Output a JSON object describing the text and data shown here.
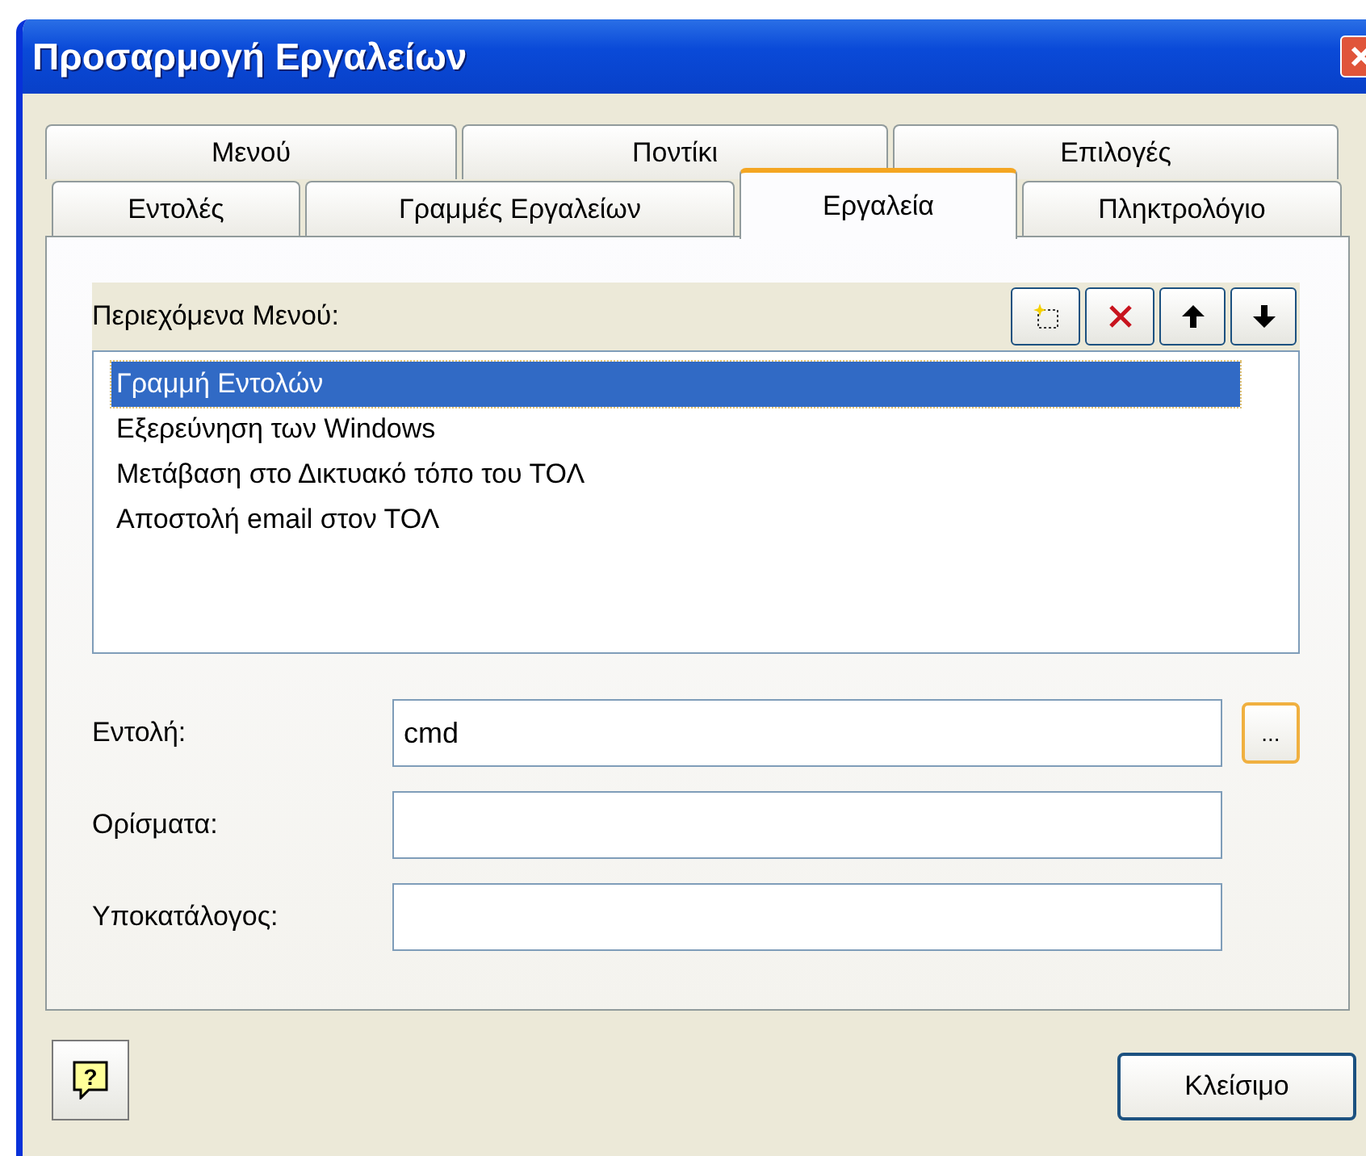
{
  "window": {
    "title": "Προσαρμογή Εργαλείων"
  },
  "tab_rows": [
    [
      {
        "label": "Μενού",
        "selected": false
      },
      {
        "label": "Ποντίκι",
        "selected": false
      },
      {
        "label": "Επιλογές",
        "selected": false
      }
    ],
    [
      {
        "label": "Εντολές",
        "selected": false
      },
      {
        "label": "Γραμμές Εργαλείων",
        "selected": false
      },
      {
        "label": "Εργαλεία",
        "selected": true
      },
      {
        "label": "Πληκτρολόγιο",
        "selected": false
      }
    ]
  ],
  "menu_contents": {
    "label": "Περιεχόμενα Μενού:",
    "items": [
      {
        "label": "Γραμμή Εντολών",
        "selected": true
      },
      {
        "label": "Εξερεύνηση των Windows",
        "selected": false
      },
      {
        "label": "Μετάβαση στο Δικτυακό τόπο του ΤΟΛ",
        "selected": false
      },
      {
        "label": "Αποστολή email στον ΤΟΛ",
        "selected": false
      }
    ]
  },
  "fields": [
    {
      "label": "Εντολή:",
      "value": "cmd",
      "browse": true
    },
    {
      "label": "Ορίσματα:",
      "browse": false
    },
    {
      "label": "Υποκατάλογος:",
      "browse": false
    }
  ],
  "help_button": {
    "label": "?"
  },
  "browse_button": {
    "label": "..."
  },
  "close_button": {
    "label": "Κλείσιμο"
  }
}
